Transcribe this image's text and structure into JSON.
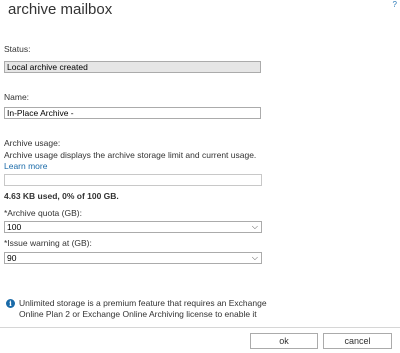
{
  "dialog": {
    "title": "archive mailbox"
  },
  "status": {
    "label": "Status:",
    "value": "Local archive created"
  },
  "name": {
    "label": "Name:",
    "value": "In-Place Archive -"
  },
  "usage": {
    "label": "Archive usage:",
    "description": "Archive usage displays the archive storage limit and current usage.",
    "learn_more": "Learn more",
    "summary": "4.63 KB used, 0% of 100 GB.",
    "fraction_used": 0.0
  },
  "quota": {
    "label": "*Archive quota (GB):",
    "selected": "100"
  },
  "warning": {
    "label": "*Issue warning at (GB):",
    "selected": "90"
  },
  "info": {
    "icon": "info-icon",
    "text": "Unlimited storage is a premium feature that requires an Exchange Online Plan 2 or Exchange Online Archiving license to enable it"
  },
  "buttons": {
    "ok": "ok",
    "cancel": "cancel"
  },
  "colors": {
    "accent": "#1a6aa8",
    "readonly_bg": "#e6e6e6"
  }
}
